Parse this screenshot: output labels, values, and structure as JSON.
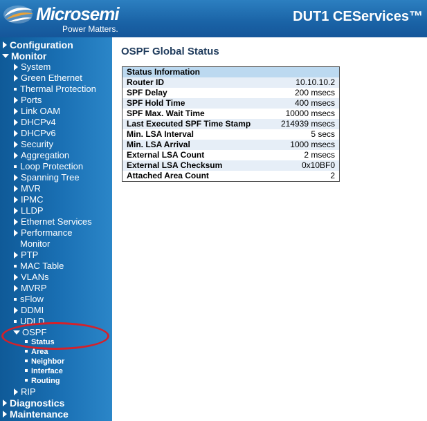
{
  "header": {
    "logo_text": "Microsemi",
    "logo_tagline": "Power Matters.",
    "device_title": "DUT1 CEServices™",
    "colors": {
      "header_blue": "#1a63a6",
      "logo_mark_accent": "#e8a23a"
    }
  },
  "sidebar": {
    "configuration": "Configuration",
    "monitor": "Monitor",
    "monitor_items": {
      "system": "System",
      "green_ethernet": "Green Ethernet",
      "thermal_protection": "Thermal Protection",
      "ports": "Ports",
      "link_oam": "Link OAM",
      "dhcpv4": "DHCPv4",
      "dhcpv6": "DHCPv6",
      "security": "Security",
      "aggregation": "Aggregation",
      "loop_protection": "Loop Protection",
      "spanning_tree": "Spanning Tree",
      "mvr": "MVR",
      "ipmc": "IPMC",
      "lldp": "LLDP",
      "ethernet_services": "Ethernet Services",
      "performance": "Performance",
      "performance_cont": "Monitor",
      "ptp": "PTP",
      "mac_table": "MAC Table",
      "vlans": "VLANs",
      "mvrp": "MVRP",
      "sflow": "sFlow",
      "ddmi": "DDMI",
      "udld": "UDLD",
      "ospf": "OSPF",
      "rip": "RIP"
    },
    "ospf_items": {
      "status": "Status",
      "area": "Area",
      "neighbor": "Neighbor",
      "interface": "Interface",
      "routing": "Routing"
    },
    "diagnostics": "Diagnostics",
    "maintenance": "Maintenance",
    "colors": {
      "highlight": "#d4212a"
    }
  },
  "main": {
    "title": "OSPF Global Status",
    "table": {
      "header": "Status Information",
      "rows": [
        {
          "label": "Router ID",
          "value": "10.10.10.2"
        },
        {
          "label": "SPF Delay",
          "value": "200 msecs"
        },
        {
          "label": "SPF Hold Time",
          "value": "400 msecs"
        },
        {
          "label": "SPF Max. Wait Time",
          "value": "10000 msecs"
        },
        {
          "label": "Last Executed SPF Time Stamp",
          "value": "214939 msecs"
        },
        {
          "label": "Min. LSA Interval",
          "value": "5 secs"
        },
        {
          "label": "Min. LSA Arrival",
          "value": "1000 msecs"
        },
        {
          "label": "External LSA Count",
          "value": "2 msecs"
        },
        {
          "label": "External LSA Checksum",
          "value": "0x10BF0"
        },
        {
          "label": "Attached Area Count",
          "value": "2"
        }
      ],
      "colors": {
        "header_bg": "#bcd9f0",
        "row_alt": "#e6eef7"
      }
    }
  }
}
